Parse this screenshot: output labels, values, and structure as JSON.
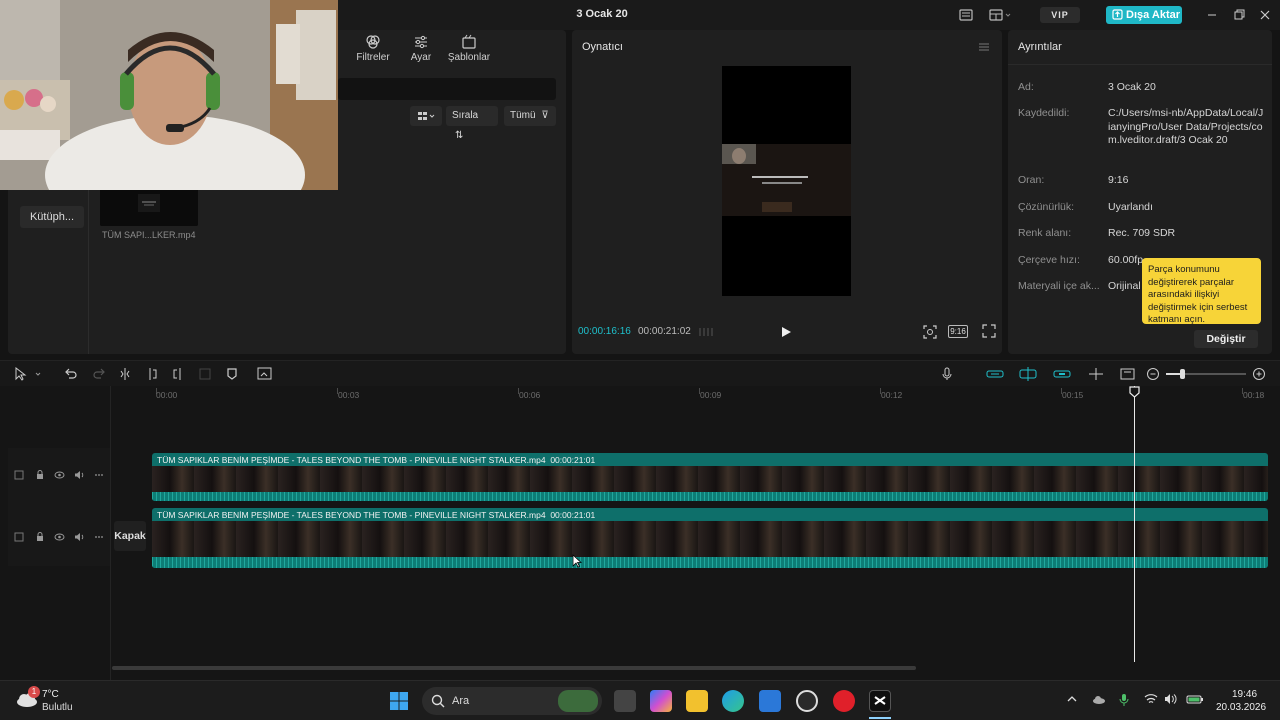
{
  "app": {
    "title": "3 Ocak 20",
    "vip_label": "VIP",
    "export_label": "Dışa Aktar",
    "accent_color": "#1fb7c6"
  },
  "media_panel": {
    "tabs": [
      {
        "label": "Filtreler",
        "icon": "filter-icon"
      },
      {
        "label": "Ayar",
        "icon": "sliders-icon"
      },
      {
        "label": "Şablonlar",
        "icon": "template-icon"
      }
    ],
    "sort_label": "Sırala",
    "filter_label": "Tümü",
    "library_button": "Kütüph...",
    "media_items": [
      {
        "name": "TÜM SAPI...LKER.mp4"
      }
    ]
  },
  "player": {
    "title": "Oynatıcı",
    "current_time": "00:00:16:16",
    "total_time": "00:00:21:02",
    "ratio_label": "9:16"
  },
  "details": {
    "title": "Ayrıntılar",
    "rows": [
      {
        "key": "Ad:",
        "value": "3 Ocak 20"
      },
      {
        "key": "Kaydedildi:",
        "value": "C:/Users/msi-nb/AppData/Local/JianyingPro/User Data/Projects/com.lveditor.draft/3 Ocak 20"
      },
      {
        "key": "Oran:",
        "value": "9:16"
      },
      {
        "key": "Çözünürlük:",
        "value": "Uyarlandı"
      },
      {
        "key": "Renk alanı:",
        "value": "Rec. 709 SDR"
      },
      {
        "key": "Çerçeve hızı:",
        "value": "60.00fp"
      },
      {
        "key": "Materyali içe ak...",
        "value": "Orijinal"
      }
    ],
    "tooltip": "Parça konumunu değiştirerek parçalar arasındaki ilişkiyi değiştirmek için serbest katmanı açın.",
    "change_button": "Değiştir"
  },
  "timeline": {
    "ruler": [
      "00:00",
      "00:03",
      "00:06",
      "00:09",
      "00:12",
      "00:15",
      "00:18"
    ],
    "cover_label": "Kapak",
    "clips": [
      {
        "title": "TÜM SAPIKLAR BENİM PEŞİMDE - TALES BEYOND THE TOMB - PINEVILLE NIGHT STALKER.mp4",
        "duration": "00:00:21:01"
      },
      {
        "title": "TÜM SAPIKLAR BENİM PEŞİMDE - TALES BEYOND THE TOMB - PINEVILLE NIGHT STALKER.mp4",
        "duration": "00:00:21:01"
      }
    ],
    "playhead_time_fraction": 0.79
  },
  "taskbar": {
    "weather_temp": "7°C",
    "weather_desc": "Bulutlu",
    "weather_badge": "1",
    "search_placeholder": "Ara",
    "time": "19:46",
    "date": "20.03.2026"
  }
}
